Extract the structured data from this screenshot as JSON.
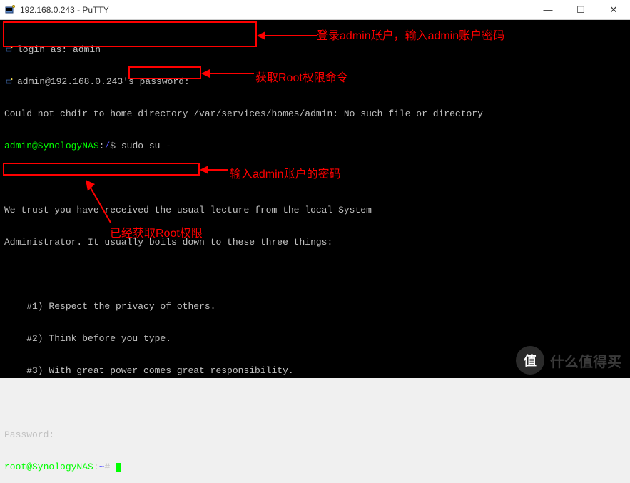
{
  "window": {
    "title": "192.168.0.243 - PuTTY",
    "controls": {
      "minimize": "—",
      "maximize": "☐",
      "close": "✕"
    }
  },
  "terminal": {
    "login_prompt": "login as: ",
    "login_user": "admin",
    "pw_prompt_user": "admin@192.168.0.243's password:",
    "chdir_err": "Could not chdir to home directory /var/services/homes/admin: No such file or directory",
    "prompt1_user": "admin@SynologyNAS",
    "prompt1_sep": ":",
    "prompt1_path": "/",
    "prompt1_dollar": "$ ",
    "sudo_cmd": "sudo su -",
    "lecture_l1": "We trust you have received the usual lecture from the local System",
    "lecture_l2": "Administrator. It usually boils down to these three things:",
    "lecture_r1": "    #1) Respect the privacy of others.",
    "lecture_r2": "    #2) Think before you type.",
    "lecture_r3": "    #3) With great power comes great responsibility.",
    "password_label": "Password:",
    "prompt2_user": "root@SynologyNAS",
    "prompt2_sep": ":",
    "prompt2_path": "~",
    "prompt2_hash": "# "
  },
  "annotations": {
    "a1": "登录admin账户，输入admin账户密码",
    "a2": "获取Root权限命令",
    "a3": "输入admin账户的密码",
    "a4": "已经获取Root权限"
  },
  "watermark": {
    "circle": "值",
    "text": "什么值得买"
  }
}
